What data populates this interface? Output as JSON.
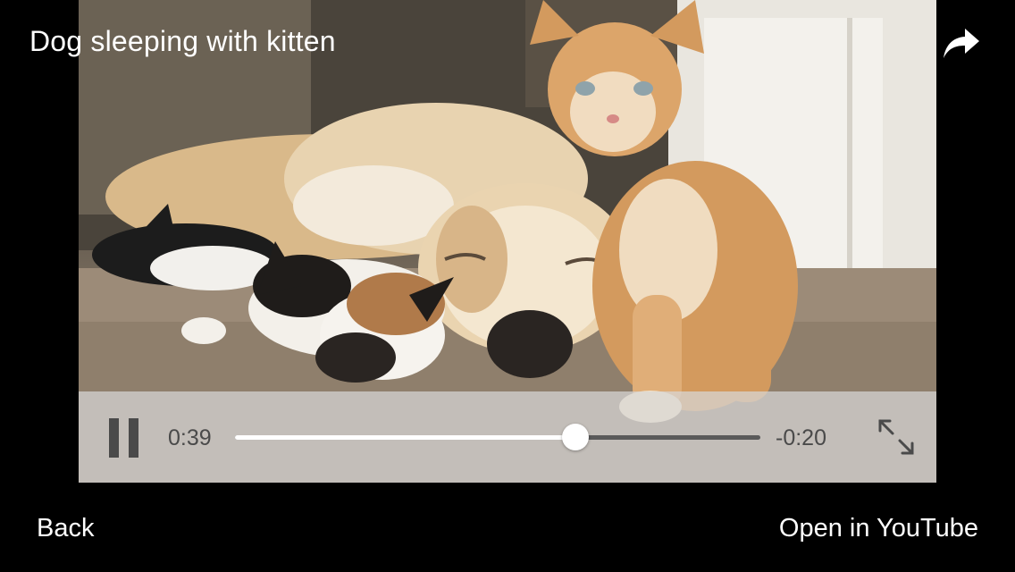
{
  "video": {
    "title": "Dog sleeping with kitten",
    "elapsed": "0:39",
    "remaining": "-0:20",
    "progress_fraction": 0.648,
    "state": "playing"
  },
  "icons": {
    "share": "share-arrow-icon",
    "pause": "pause-icon",
    "fullscreen": "expand-icon"
  },
  "nav": {
    "back_label": "Back",
    "open_label": "Open in YouTube"
  },
  "colors": {
    "background": "#000000",
    "controls_bar": "#d7d7d7",
    "control_glyph": "#4a4a4a",
    "track_played": "#ffffff",
    "track_remaining": "#5a5a5a",
    "text": "#ffffff"
  }
}
